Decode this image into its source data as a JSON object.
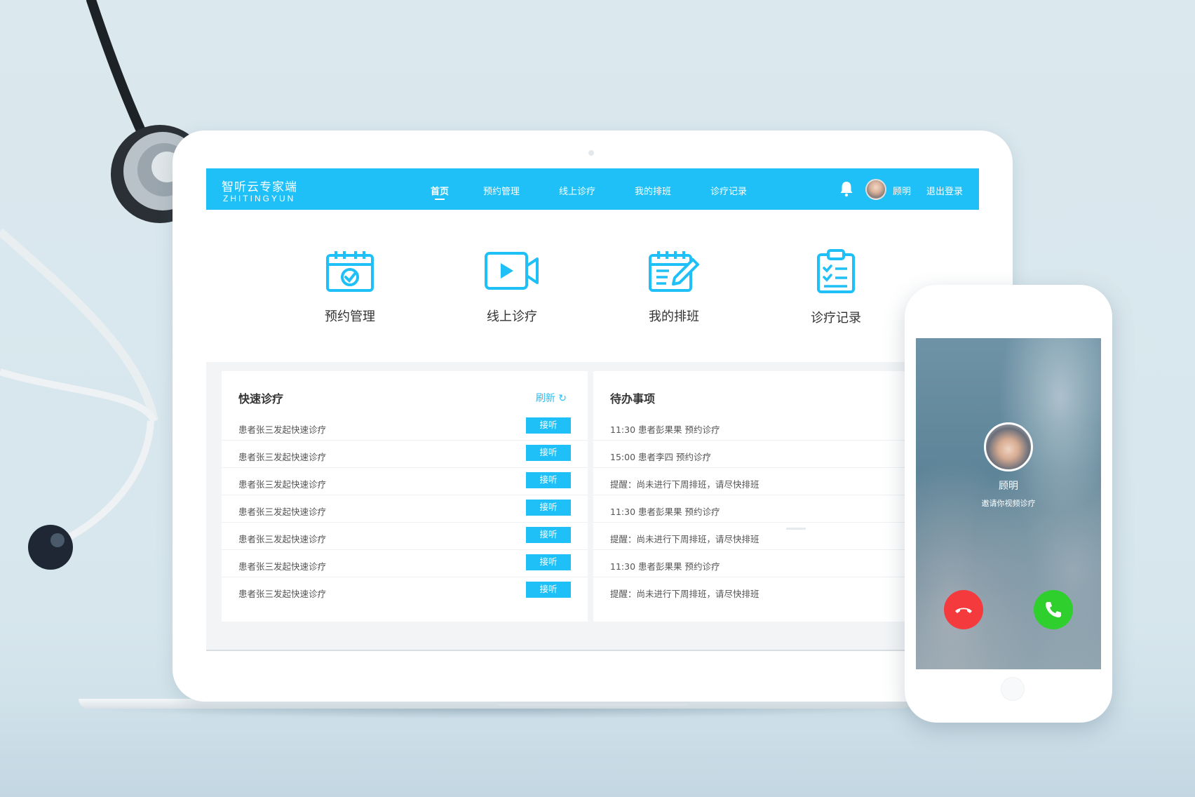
{
  "colors": {
    "accent": "#1ec0f7",
    "decline": "#f43a3c",
    "answer": "#2fcf2e"
  },
  "nav": {
    "brand_title": "智听云专家端",
    "brand_sub": "ZHITINGYUN",
    "items": [
      {
        "label": "首页",
        "active": true
      },
      {
        "label": "预约管理"
      },
      {
        "label": "线上诊疗"
      },
      {
        "label": "我的排班"
      },
      {
        "label": "诊疗记录"
      }
    ],
    "user_name": "顾明",
    "logout": "退出登录",
    "bell_icon": "bell-icon"
  },
  "quick_entries": [
    {
      "label": "预约管理",
      "icon": "calendar-check-icon"
    },
    {
      "label": "线上诊疗",
      "icon": "video-camera-icon"
    },
    {
      "label": "我的排班",
      "icon": "schedule-edit-icon"
    },
    {
      "label": "诊疗记录",
      "icon": "clipboard-checklist-icon"
    }
  ],
  "fast_consult": {
    "title": "快速诊疗",
    "refresh": "刷新",
    "accept_label": "接听",
    "rows": [
      "患者张三发起快速诊疗",
      "患者张三发起快速诊疗",
      "患者张三发起快速诊疗",
      "患者张三发起快速诊疗",
      "患者张三发起快速诊疗",
      "患者张三发起快速诊疗",
      "患者张三发起快速诊疗"
    ]
  },
  "todo": {
    "title": "待办事项",
    "rows": [
      "11:30 患者彭果果 预约诊疗",
      "15:00 患者李四 预约诊疗",
      "提醒：尚未进行下周排班，请尽快排班",
      "11:30 患者彭果果 预约诊疗",
      "提醒：尚未进行下周排班，请尽快排班",
      "11:30 患者彭果果 预约诊疗",
      "提醒：尚未进行下周排班，请尽快排班"
    ]
  },
  "phone_call": {
    "caller": "顾明",
    "subtitle": "邀请你视频诊疗",
    "decline_icon": "hang-up-icon",
    "answer_icon": "phone-answer-icon"
  }
}
